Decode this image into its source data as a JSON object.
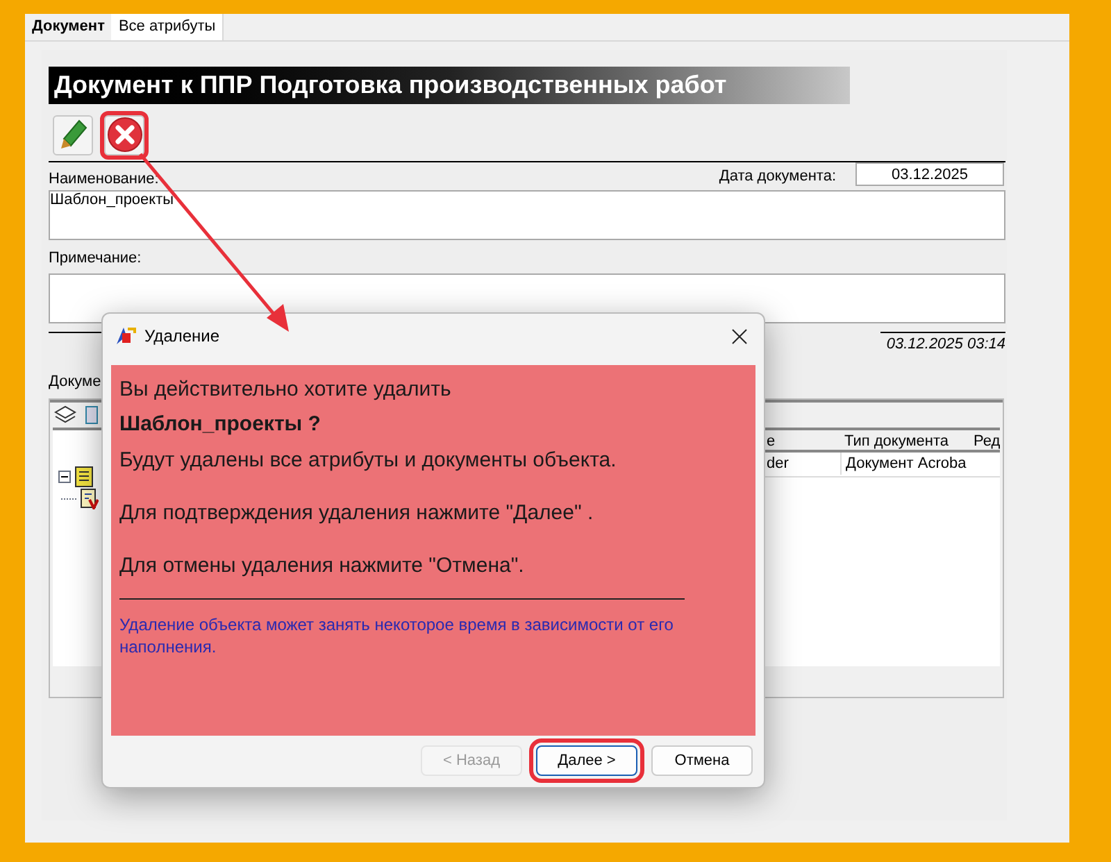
{
  "tabs": [
    {
      "label": "Документ",
      "selected": true
    },
    {
      "label": "Все атрибуты",
      "selected": false
    }
  ],
  "title": "Документ к ППР Подготовка производственных работ",
  "toolbar": [
    {
      "kind": "edit",
      "highlighted": false
    },
    {
      "kind": "delete",
      "highlighted": true
    }
  ],
  "name_label": "Наименование:",
  "name_value": "Шаблон_проекты",
  "date_label": "Дата документа:",
  "date_value": "03.12.2025",
  "note_label": "Примечание:",
  "timestamp": "03.12.2025 03:14",
  "documents_label": "Докуме",
  "tree": [
    {
      "kind": "folder",
      "expanded": true,
      "children": [
        {
          "kind": "document"
        }
      ]
    }
  ],
  "grid": {
    "columns": [
      "е",
      "Тип документа",
      "Ред"
    ],
    "rows": [
      {
        "cells": [
          "der",
          "Документ Acroba"
        ]
      }
    ]
  },
  "dialog": {
    "title": "Удаление",
    "question": "Вы действительно хотите удалить",
    "object": "Шаблон_проекты ?",
    "lines": [
      "Будут удалены все атрибуты и документы объекта.",
      "Для подтверждения удаления нажмите \"Далее\" .",
      "Для отмены удаления нажмите \"Отмена\"."
    ],
    "note": "Удаление объекта может занять некоторое время в зависимости от его наполнения.",
    "buttons": [
      {
        "label": "< Назад",
        "disabled": true,
        "focused": false,
        "highlighted": false
      },
      {
        "label": "Далее >",
        "disabled": false,
        "focused": true,
        "highlighted": true
      },
      {
        "label": "Отмена",
        "disabled": false,
        "focused": false,
        "highlighted": false
      }
    ]
  }
}
